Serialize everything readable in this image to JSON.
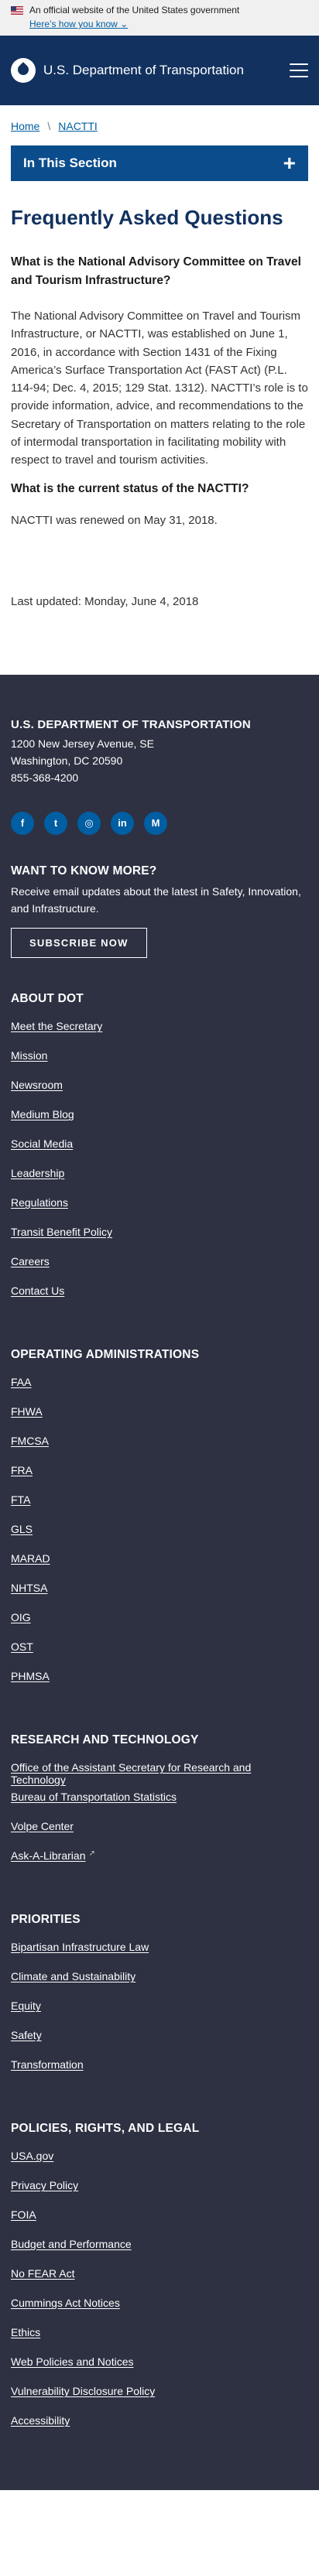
{
  "gov_banner": {
    "text": "An official website of the United States government",
    "link": "Here’s how you know",
    "chevron_icon": "chevron-down-icon"
  },
  "header": {
    "agency": "U.S. Department of Transportation",
    "logo_icon": "dot-logo-icon",
    "menu_icon": "hamburger-menu-icon"
  },
  "breadcrumb": {
    "home": "Home",
    "separator": "\\",
    "current": "NACTTI"
  },
  "section_nav": {
    "label": "In This Section",
    "toggle": "+"
  },
  "content": {
    "title": "Frequently Asked Questions",
    "q1": "What is the National Advisory Committee on Travel and Tourism Infrastructure?",
    "a1": "The National Advisory Committee on Travel and Tourism Infrastructure, or NACTTI, was established on June 1, 2016, in accordance with Section 1431 of the Fixing America’s Surface Transportation Act (FAST Act) (P.L. 114-94; Dec. 4, 2015; 129 Stat. 1312).  NACTTI’s role is to provide information, advice, and recommendations to the Secretary of Transportation on matters relating to the role of intermodal transportation in facilitating mobility with respect to travel and tourism activities.",
    "q2": "What is the current status of the NACTTI?",
    "a2": "NACTTI was renewed on May 31, 2018.",
    "last_updated": "Last updated: Monday, June 4, 2018"
  },
  "footer": {
    "org": "U.S. DEPARTMENT OF TRANSPORTATION",
    "address1": "1200 New Jersey Avenue, SE",
    "address2": "Washington, DC 20590",
    "phone": "855-368-4200",
    "socials": [
      {
        "icon": "facebook-icon",
        "glyph": "f"
      },
      {
        "icon": "twitter-icon",
        "glyph": "t"
      },
      {
        "icon": "instagram-icon",
        "glyph": "◎"
      },
      {
        "icon": "linkedin-icon",
        "glyph": "in"
      },
      {
        "icon": "medium-icon",
        "glyph": "M"
      }
    ],
    "want_heading": "WANT TO KNOW MORE?",
    "want_text": "Receive email updates about the latest in Safety, Innovation, and Infrastructure.",
    "subscribe": "SUBSCRIBE NOW",
    "about": {
      "heading": "ABOUT DOT",
      "links": [
        "Meet the Secretary",
        "Mission",
        "Newsroom",
        "Medium Blog",
        "Social Media",
        "Leadership",
        "Regulations",
        "Transit Benefit Policy",
        "Careers",
        "Contact Us"
      ]
    },
    "operating": {
      "heading": "OPERATING ADMINISTRATIONS",
      "links": [
        "FAA",
        "FHWA",
        "FMCSA",
        "FRA",
        "FTA",
        "GLS",
        "MARAD",
        "NHTSA",
        "OIG",
        "OST",
        "PHMSA"
      ]
    },
    "research": {
      "heading": "RESEARCH AND TECHNOLOGY",
      "links": [
        "Office of the Assistant Secretary for Research and Technology",
        "Bureau of Transportation Statistics",
        "Volpe Center",
        "Ask-A-Librarian"
      ],
      "external_icon": "external-link-icon"
    },
    "priorities": {
      "heading": "PRIORITIES",
      "links": [
        "Bipartisan Infrastructure Law",
        "Climate and Sustainability",
        "Equity",
        "Safety",
        "Transformation"
      ]
    },
    "policies": {
      "heading": "POLICIES, RIGHTS, AND LEGAL",
      "links": [
        "USA.gov",
        "Privacy Policy",
        "FOIA",
        "Budget and Performance",
        "No FEAR Act",
        "Cummings Act Notices",
        "Ethics",
        "Web Policies and Notices",
        "Vulnerability Disclosure Policy",
        "Accessibility"
      ]
    }
  },
  "colors": {
    "header_bg": "#12315f",
    "section_bar": "#0b4d8c",
    "footer_bg": "#2d3142",
    "link": "#005ea2"
  }
}
